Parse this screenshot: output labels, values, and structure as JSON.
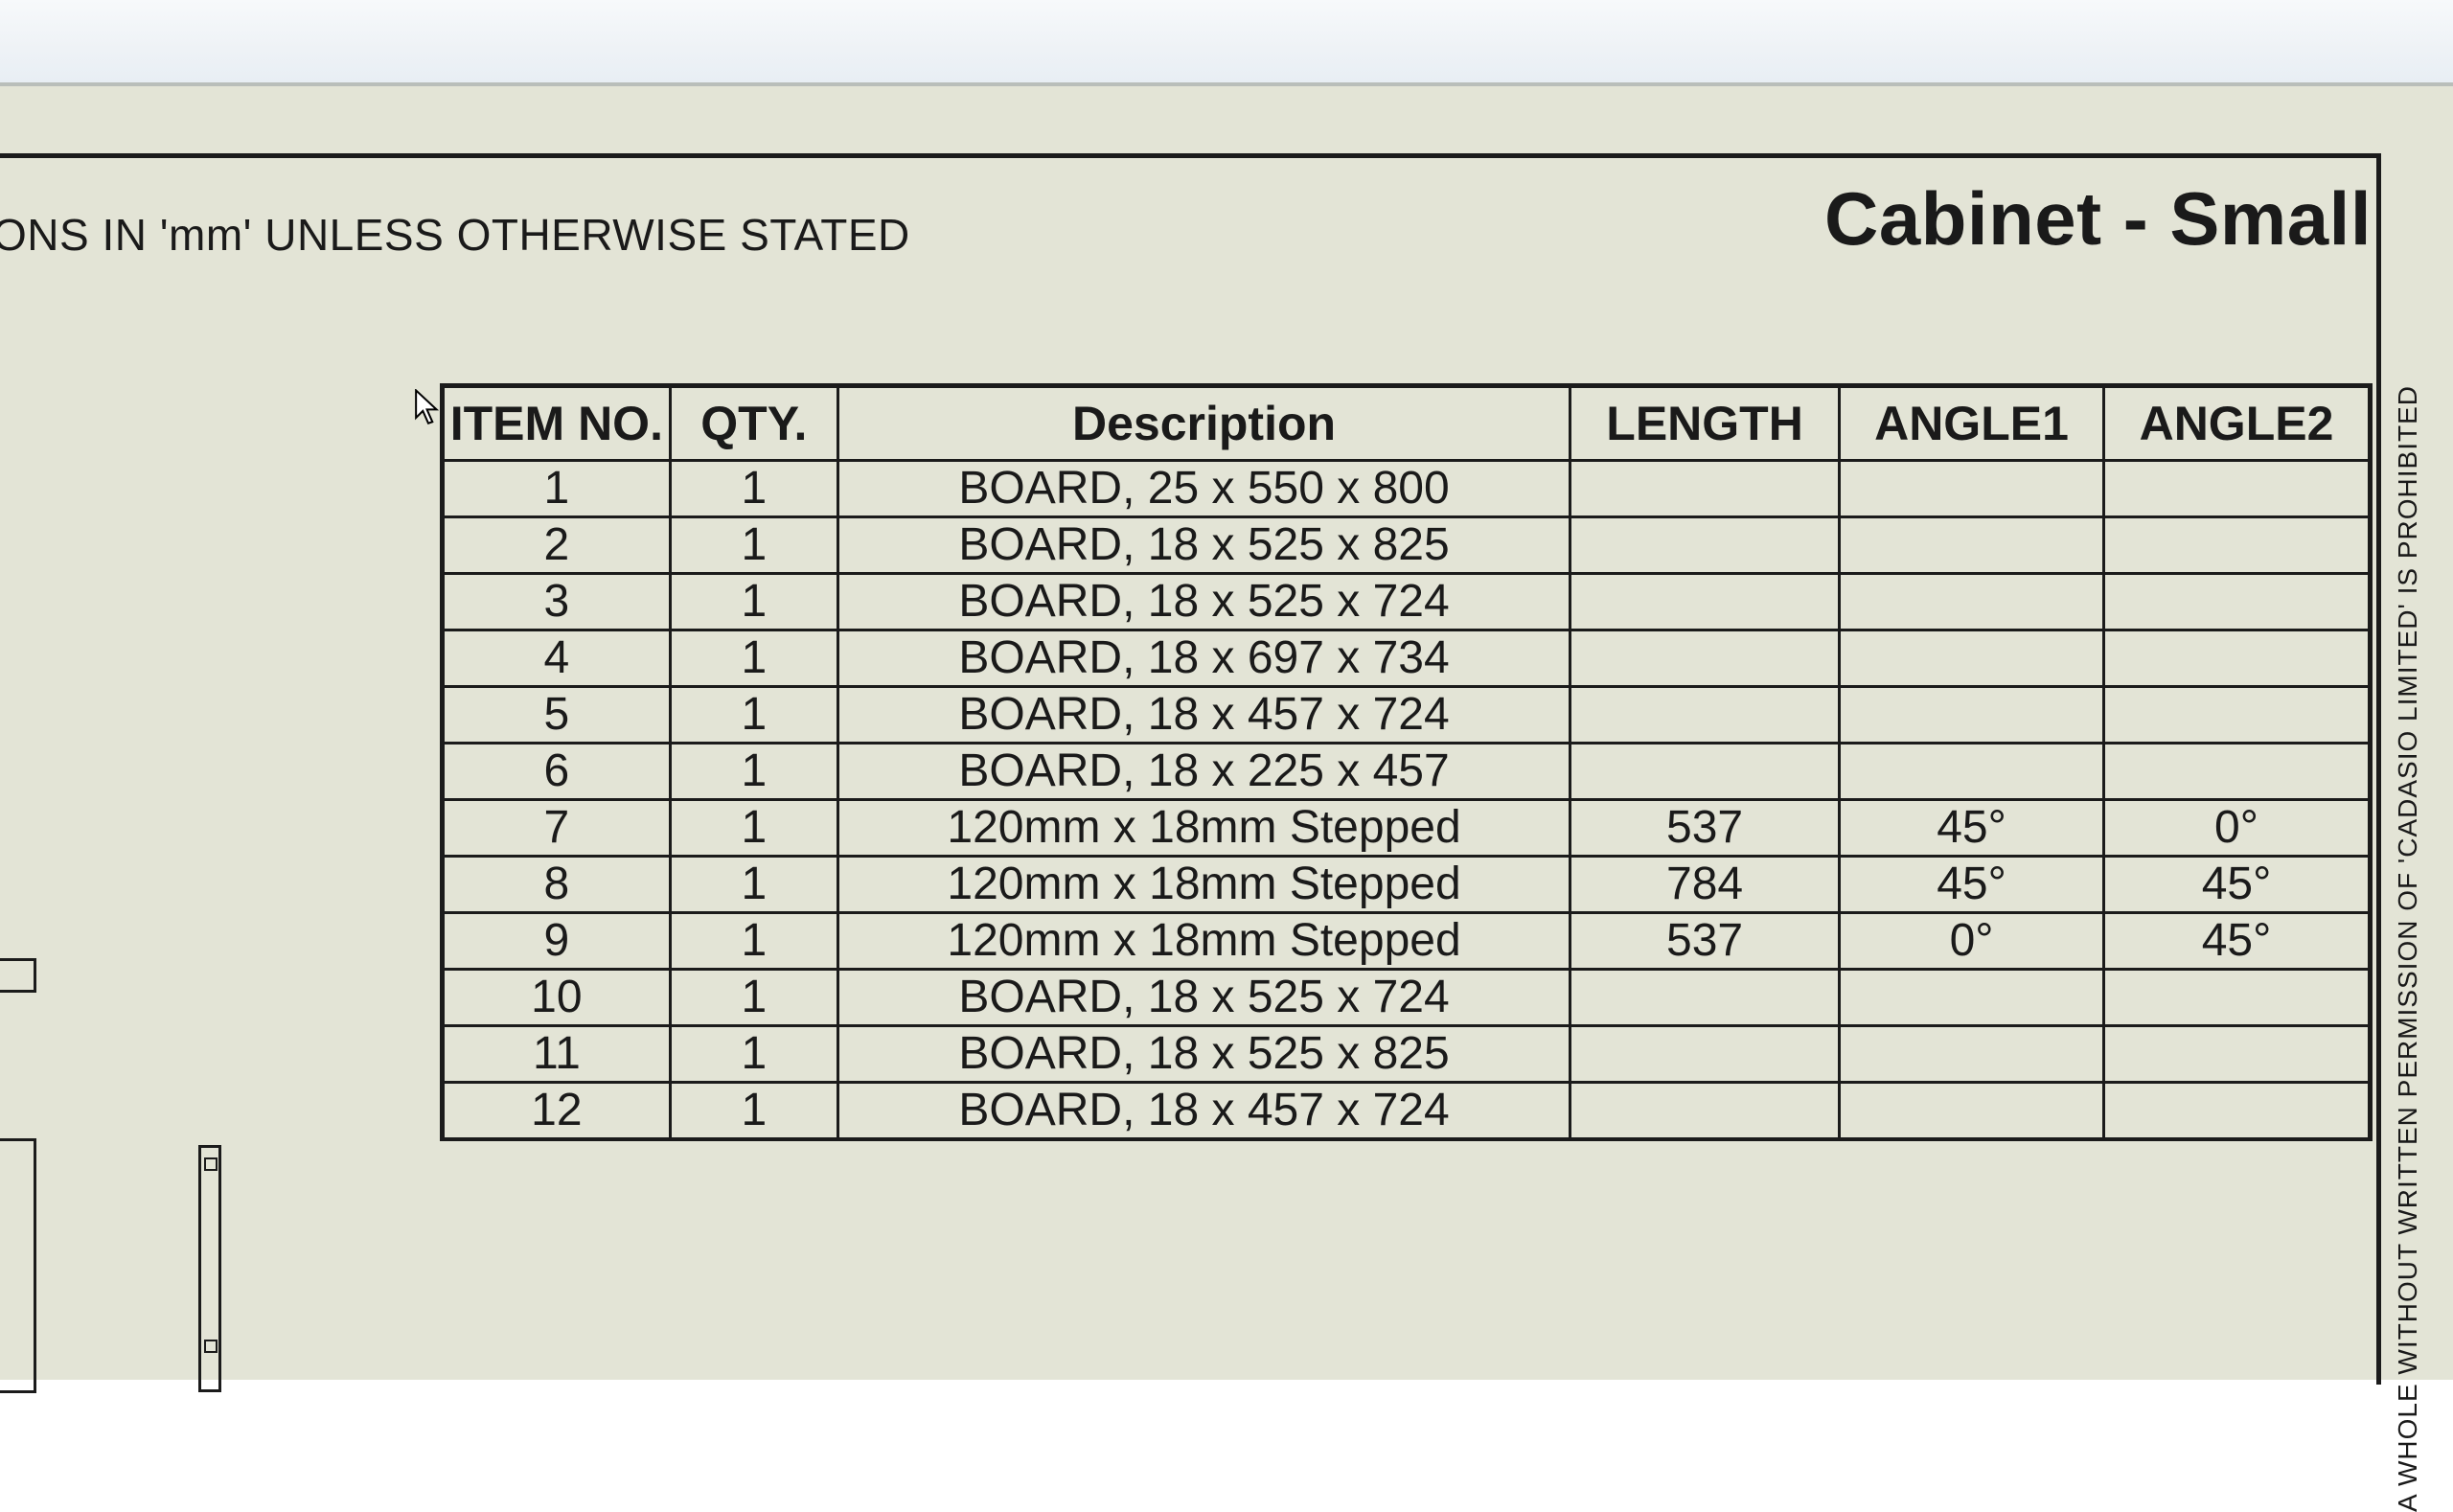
{
  "note_text": "ONS IN 'mm' UNLESS OTHERWISE STATED",
  "title": "Cabinet - Small",
  "copyright_text": "A WHOLE WITHOUT WRITTEN PERMISSION OF 'CADASIO LIMITED' IS PROHIBITED",
  "headers": {
    "item_no": "ITEM NO.",
    "qty": "QTY.",
    "description": "Description",
    "length": "LENGTH",
    "angle1": "ANGLE1",
    "angle2": "ANGLE2"
  },
  "rows": [
    {
      "item": "1",
      "qty": "1",
      "desc": "BOARD, 25 x 550 x 800",
      "len": "",
      "a1": "",
      "a2": ""
    },
    {
      "item": "2",
      "qty": "1",
      "desc": "BOARD, 18 x 525 x 825",
      "len": "",
      "a1": "",
      "a2": ""
    },
    {
      "item": "3",
      "qty": "1",
      "desc": "BOARD, 18 x 525 x 724",
      "len": "",
      "a1": "",
      "a2": ""
    },
    {
      "item": "4",
      "qty": "1",
      "desc": "BOARD, 18 x 697 x 734",
      "len": "",
      "a1": "",
      "a2": ""
    },
    {
      "item": "5",
      "qty": "1",
      "desc": "BOARD, 18 x 457 x 724",
      "len": "",
      "a1": "",
      "a2": ""
    },
    {
      "item": "6",
      "qty": "1",
      "desc": "BOARD, 18 x 225 x 457",
      "len": "",
      "a1": "",
      "a2": ""
    },
    {
      "item": "7",
      "qty": "1",
      "desc": "120mm x 18mm Stepped",
      "len": "537",
      "a1": "45°",
      "a2": "0°"
    },
    {
      "item": "8",
      "qty": "1",
      "desc": "120mm x 18mm Stepped",
      "len": "784",
      "a1": "45°",
      "a2": "45°"
    },
    {
      "item": "9",
      "qty": "1",
      "desc": "120mm x 18mm Stepped",
      "len": "537",
      "a1": "0°",
      "a2": "45°"
    },
    {
      "item": "10",
      "qty": "1",
      "desc": "BOARD, 18 x 525 x 724",
      "len": "",
      "a1": "",
      "a2": ""
    },
    {
      "item": "11",
      "qty": "1",
      "desc": "BOARD, 18 x 525 x 825",
      "len": "",
      "a1": "",
      "a2": ""
    },
    {
      "item": "12",
      "qty": "1",
      "desc": "BOARD, 18 x 457 x 724",
      "len": "",
      "a1": "",
      "a2": ""
    }
  ],
  "chart_data": {
    "type": "table",
    "title": "Cabinet - Small",
    "columns": [
      "ITEM NO.",
      "QTY.",
      "Description",
      "LENGTH",
      "ANGLE1",
      "ANGLE2"
    ],
    "rows": [
      [
        1,
        1,
        "BOARD, 25 x 550 x 800",
        null,
        null,
        null
      ],
      [
        2,
        1,
        "BOARD, 18 x 525 x 825",
        null,
        null,
        null
      ],
      [
        3,
        1,
        "BOARD, 18 x 525 x 724",
        null,
        null,
        null
      ],
      [
        4,
        1,
        "BOARD, 18 x 697 x 734",
        null,
        null,
        null
      ],
      [
        5,
        1,
        "BOARD, 18 x 457 x 724",
        null,
        null,
        null
      ],
      [
        6,
        1,
        "BOARD, 18 x 225 x 457",
        null,
        null,
        null
      ],
      [
        7,
        1,
        "120mm x 18mm Stepped",
        537,
        45,
        0
      ],
      [
        8,
        1,
        "120mm x 18mm Stepped",
        784,
        45,
        45
      ],
      [
        9,
        1,
        "120mm x 18mm Stepped",
        537,
        0,
        45
      ],
      [
        10,
        1,
        "BOARD, 18 x 525 x 724",
        null,
        null,
        null
      ],
      [
        11,
        1,
        "BOARD, 18 x 525 x 825",
        null,
        null,
        null
      ],
      [
        12,
        1,
        "BOARD, 18 x 457 x 724",
        null,
        null,
        null
      ]
    ]
  }
}
